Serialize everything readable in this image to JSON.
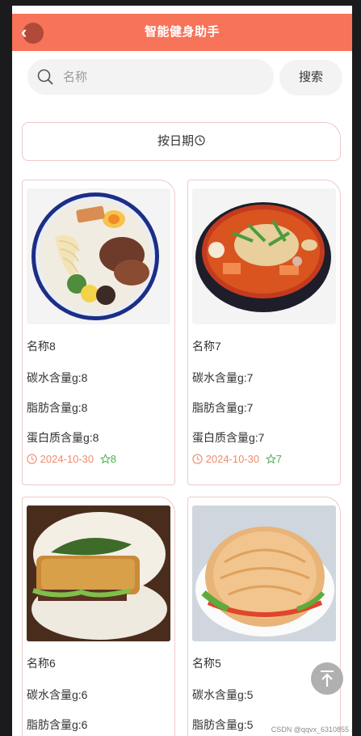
{
  "header": {
    "title": "智能健身助手"
  },
  "search": {
    "placeholder": "名称",
    "button_label": "搜索"
  },
  "sort": {
    "label": "按日期"
  },
  "cards": [
    {
      "name": "名称8",
      "carbs": "碳水含量g:8",
      "fat": "脂肪含量g:8",
      "protein": "蛋白质含量g:8",
      "date": "2024-10-30",
      "favorites": "8"
    },
    {
      "name": "名称7",
      "carbs": "碳水含量g:7",
      "fat": "脂肪含量g:7",
      "protein": "蛋白质含量g:7",
      "date": "2024-10-30",
      "favorites": "7"
    },
    {
      "name": "名称6",
      "carbs": "碳水含量g:6",
      "fat": "脂肪含量g:6"
    },
    {
      "name": "名称5",
      "carbs": "碳水含量g:5",
      "fat": "脂肪含量g:5"
    }
  ],
  "footer": {
    "watermark": "CSDN @qqvx_6310855"
  },
  "icons": {
    "back": "chevron-left-icon",
    "search": "search-icon",
    "sort": "clock-icon",
    "date": "clock-icon",
    "favorite": "star-outline-icon",
    "scroll_top": "arrow-up-icon"
  },
  "colors": {
    "header": "#f7735a",
    "card_border": "#efc9c9",
    "date_text": "#f08a6c",
    "favorite_text": "#4caf50"
  }
}
